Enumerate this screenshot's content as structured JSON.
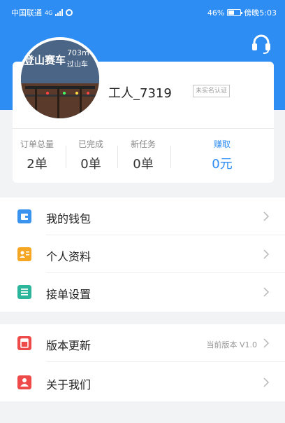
{
  "status_bar": {
    "carrier": "中国联通",
    "network": "4G",
    "battery": "46%",
    "battery_level": 0.46,
    "time": "傍晚5:03"
  },
  "header": {
    "support_icon": "headset-icon",
    "accent_color": "#2e8df2"
  },
  "profile": {
    "username": "工人_7319",
    "verify_status": "未实名认证",
    "avatar_text_1": "登山赛车",
    "avatar_text_2": "703m",
    "avatar_text_3": "过山车"
  },
  "stats": [
    {
      "label": "订单总量",
      "value": "2单"
    },
    {
      "label": "已完成",
      "value": "0单"
    },
    {
      "label": "新任务",
      "value": "0单"
    },
    {
      "label": "赚取",
      "value": "0元"
    }
  ],
  "menu_group_1": [
    {
      "label": "我的钱包",
      "icon": "wallet-icon",
      "color": "#3b93f0"
    },
    {
      "label": "个人资料",
      "icon": "profile-card-icon",
      "color": "#f5a623"
    },
    {
      "label": "接单设置",
      "icon": "list-settings-icon",
      "color": "#2bb59a"
    }
  ],
  "menu_group_2": [
    {
      "label": "版本更新",
      "icon": "update-icon",
      "color": "#ef4a4a",
      "value": "当前版本 V1.0"
    },
    {
      "label": "关于我们",
      "icon": "about-icon",
      "color": "#ef4a4a"
    }
  ]
}
